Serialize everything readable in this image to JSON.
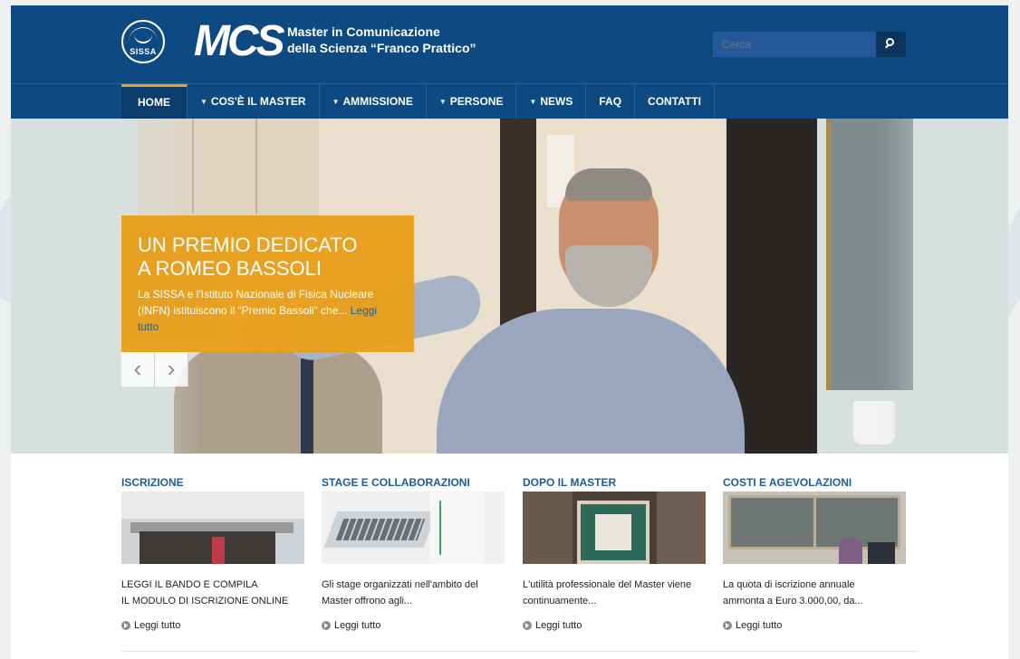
{
  "header": {
    "logo_text": "SISSA",
    "brand": "MCS",
    "subtitle_line1": "Master in Comunicazione",
    "subtitle_line2": "della Scienza “Franco Prattico”",
    "search": {
      "placeholder": "Cerca"
    }
  },
  "nav": {
    "items": [
      {
        "label": "HOME",
        "active": true,
        "has_caret": false
      },
      {
        "label": "COS'È IL MASTER",
        "active": false,
        "has_caret": true
      },
      {
        "label": "AMMISSIONE",
        "active": false,
        "has_caret": true
      },
      {
        "label": "PERSONE",
        "active": false,
        "has_caret": true
      },
      {
        "label": "NEWS",
        "active": false,
        "has_caret": true
      },
      {
        "label": "FAQ",
        "active": false,
        "has_caret": false
      },
      {
        "label": "CONTATTI",
        "active": false,
        "has_caret": false
      }
    ]
  },
  "hero": {
    "title_line1": "UN PREMIO DEDICATO",
    "title_line2": "A ROMEO BASSOLI",
    "text": "La SISSA e l'Istituto Nazionale di Fisica Nucleare (INFN) istituiscono il “Premio Bassoli” che... ",
    "link": "Leggi tutto",
    "prev_icon": "‹",
    "next_icon": "›"
  },
  "columns": [
    {
      "title": "ISCRIZIONE",
      "text_line1": "LEGGI IL BANDO E COMPILA",
      "text_line2": "IL MODULO DI ISCRIZIONE ONLINE",
      "more": "Leggi tutto"
    },
    {
      "title": "STAGE E COLLABORAZIONI",
      "text_line1": "Gli stage organizzati nell'ambito del",
      "text_line2": "Master offrono agli...",
      "more": "Leggi tutto"
    },
    {
      "title": "DOPO IL MASTER",
      "text_line1": "L'utilità professionale del Master viene",
      "text_line2": "continuamente...",
      "more": "Leggi tutto"
    },
    {
      "title": "COSTI E AGEVOLAZIONI",
      "text_line1": "La quota di iscrizione annuale",
      "text_line2": "ammonta a Euro 3.000,00, da...",
      "more": "Leggi tutto"
    }
  ],
  "colors": {
    "header_blue": "#0e4a82",
    "accent_orange": "#e8a01c",
    "title_blue": "#1c5c9a"
  }
}
